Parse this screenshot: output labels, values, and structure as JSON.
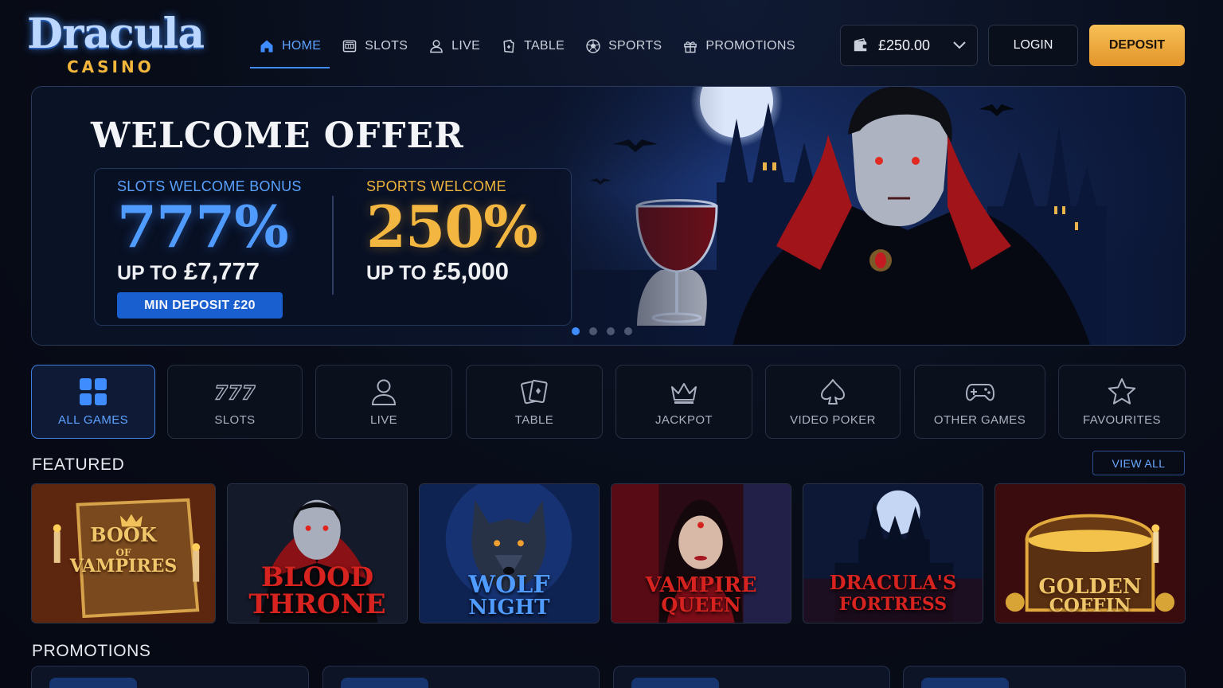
{
  "brand": {
    "name": "Dracula",
    "sub": "CASINO"
  },
  "nav": [
    {
      "label": "HOME",
      "icon": "home-icon"
    },
    {
      "label": "SLOTS",
      "icon": "slot-machine-icon"
    },
    {
      "label": "LIVE",
      "icon": "user-icon"
    },
    {
      "label": "TABLE",
      "icon": "cards-icon"
    },
    {
      "label": "SPORTS",
      "icon": "football-icon"
    },
    {
      "label": "PROMOTIONS",
      "icon": "gift-icon"
    }
  ],
  "wallet": {
    "balance": "£250.00",
    "icon": "wallet-icon"
  },
  "login_label": "LOGIN",
  "deposit_label": "DEPOSIT",
  "hero": {
    "title": "WELCOME OFFER",
    "slots": {
      "label": "SLOTS WELCOME BONUS",
      "percent": "777%",
      "up_to": "UP TO",
      "amount": "£7,777",
      "button": "MIN DEPOSIT £20"
    },
    "sports": {
      "label": "SPORTS WELCOME",
      "percent": "250%",
      "up_to": "UP TO",
      "amount": "£5,000"
    },
    "slides": 4,
    "active_slide": 0
  },
  "categories": [
    {
      "label": "ALL GAMES",
      "icon": "grid-icon"
    },
    {
      "label": "SLOTS",
      "icon": "777-icon"
    },
    {
      "label": "LIVE",
      "icon": "user-icon"
    },
    {
      "label": "TABLE",
      "icon": "cards-icon"
    },
    {
      "label": "JACKPOT",
      "icon": "crown-icon"
    },
    {
      "label": "VIDEO POKER",
      "icon": "spade-icon"
    },
    {
      "label": "OTHER GAMES",
      "icon": "gamepad-icon"
    },
    {
      "label": "FAVOURITES",
      "icon": "star-icon"
    }
  ],
  "featured": {
    "title": "FEATURED",
    "view_all": "VIEW ALL",
    "games": [
      {
        "l1": "BOOK",
        "l2": "OF",
        "l3": "VAMPIRES"
      },
      {
        "l1": "BLOOD",
        "l2": "THRONE"
      },
      {
        "l1": "WOLF",
        "l2": "NIGHT"
      },
      {
        "l1": "VAMPIRE",
        "l2": "QUEEN"
      },
      {
        "l1": "DRACULA'S",
        "l2": "FORTRESS"
      },
      {
        "l1": "GOLDEN",
        "l2": "COFFIN"
      }
    ]
  },
  "promotions": {
    "title": "PROMOTIONS"
  },
  "colors": {
    "accent": "#3f8cff",
    "gold": "#f2b63c",
    "blood": "#d6231f",
    "bg": "#070b17"
  }
}
